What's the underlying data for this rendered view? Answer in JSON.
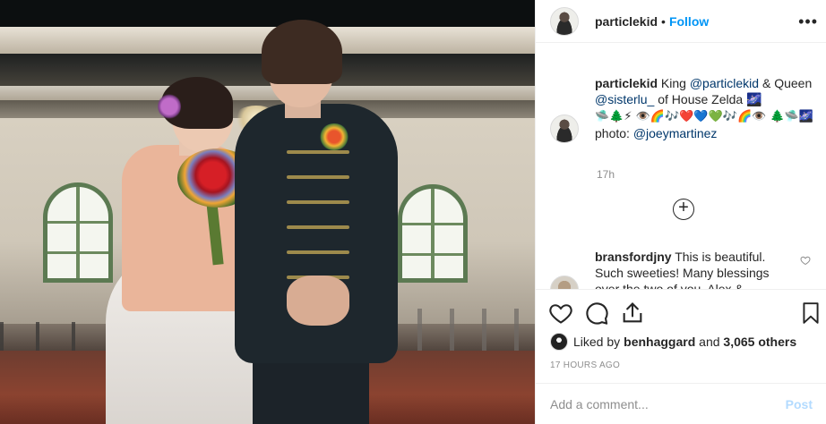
{
  "photo": {
    "alt_semantic": "wedding-photo"
  },
  "header": {
    "username": "particlekid",
    "separator": "•",
    "follow_label": "Follow",
    "more_label": "•••"
  },
  "caption": {
    "username": "particlekid",
    "text_1": " King ",
    "mention_1": "@particlekid",
    "text_2": " & Queen ",
    "mention_2": "@sisterlu_",
    "text_3": " of House Zelda 🌌",
    "emoji_line": "🛸🌲⚡ 👁️🌈🎶❤️💙💚🎶🌈👁️ 🌲🛸🌌",
    "photo_label": "photo: ",
    "photo_mention": "@joeymartinez",
    "time": "17h"
  },
  "comment": {
    "username": "bransfordjny",
    "text": " This is beautiful. Such sweeties! Many blessings over the two of you. Alex &"
  },
  "likes": {
    "prefix": "Liked by ",
    "user": "benhaggard",
    "middle": " and ",
    "count": "3,065 others"
  },
  "posted_time": "17 HOURS AGO",
  "add_comment": {
    "placeholder": "Add a comment...",
    "post_label": "Post"
  },
  "colors": {
    "accent": "#0095f6",
    "mention": "#00376b",
    "muted": "#8e8e8e",
    "post_disabled": "#b3dbff"
  },
  "icons": [
    "heart-icon",
    "comment-icon",
    "share-icon",
    "bookmark-icon",
    "plus-circle-icon",
    "more-icon"
  ]
}
